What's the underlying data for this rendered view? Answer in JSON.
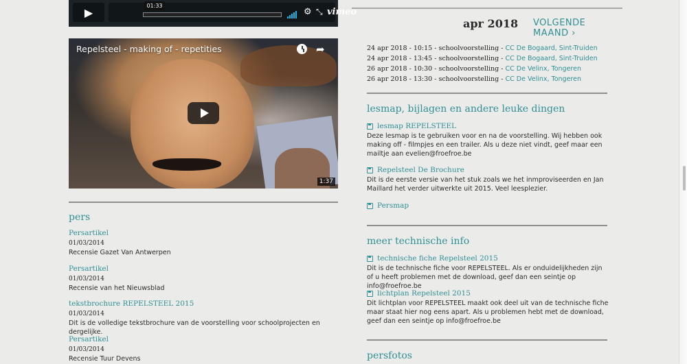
{
  "video_top": {
    "time": "01:33",
    "brand": "vimeo"
  },
  "video2": {
    "title": "Repelsteel - making of - repetities",
    "duration": "1:37"
  },
  "pers": {
    "heading": "pers",
    "items": [
      {
        "title": "Persartikel",
        "date": "01/03/2014",
        "desc": "Recensie Gazet Van Antwerpen"
      },
      {
        "title": "Persartikel",
        "date": "01/03/2014",
        "desc": "Recensie van het Nieuwsblad"
      },
      {
        "title": "tekstbrochure REPELSTEEL 2015",
        "date": "01/03/2014",
        "desc": "Dit is de volledige tekstbrochure van de voorstelling voor schoolprojecten en dergelijke."
      },
      {
        "title": "Persartikel",
        "date": "01/03/2014",
        "desc": "Recensie Tuur Devens"
      }
    ]
  },
  "calendar": {
    "month": "apr 2018",
    "next_label": "VOLGENDE MAAND ›",
    "events": [
      {
        "date": "24 apr 2018 - 10:15 - schoolvoorstelling - ",
        "venue": "CC De Bogaard, Sint-Truiden"
      },
      {
        "date": "24 apr 2018 - 13:45 - schoolvoorstelling - ",
        "venue": "CC De Bogaard, Sint-Truiden"
      },
      {
        "date": "26 apr 2018 - 10:30 - schoolvoorstelling - ",
        "venue": "CC De Velinx, Tongeren"
      },
      {
        "date": "26 apr 2018 - 13:30 - schoolvoorstelling - ",
        "venue": "CC De Velinx, Tongeren"
      }
    ]
  },
  "lesmap": {
    "heading": "lesmap, bijlagen en andere leuke dingen",
    "items": [
      {
        "title": "lesmap REPELSTEEL",
        "desc": "Deze lesmap is te gebruiken voor en na de voorstelling. Wij hebben ook making off - filmpjes en een trailer. Als u deze niet vindt, geef maar een mailtje aan evelien@froefroe.be"
      },
      {
        "title": "Repelsteel De Brochure",
        "desc": "Dit is de eerste versie van het stuk zoals we het inmproviseerden en Jan Maillard het verder uitwerkte uit 2015. Veel leesplezier."
      },
      {
        "title": "Persmap",
        "desc": ""
      }
    ]
  },
  "tech": {
    "heading": "meer technische info",
    "items": [
      {
        "title": "technische fiche Repelsteel 2015",
        "desc": "Dit is de technische fiche voor REPELSTEEL. Als er onduidelijkheden zijn of u heeft problemen met de download, geef dan een seintje op info@froefroe.be"
      },
      {
        "title": "lichtplan Repelsteel 2015",
        "desc": "Dit lichtplan voor REPELSTEEL maakt ook deel uit van de technische fiche maar staat hier nog eens apart. Als u problemen hebt met de download, geef dan een seintje op info@froefroe.be"
      }
    ]
  },
  "persfotos": {
    "heading": "persfotos"
  },
  "colors": {
    "accent": "#2f8f92",
    "rule": "#8f8f8f",
    "background": "#ebebea"
  }
}
